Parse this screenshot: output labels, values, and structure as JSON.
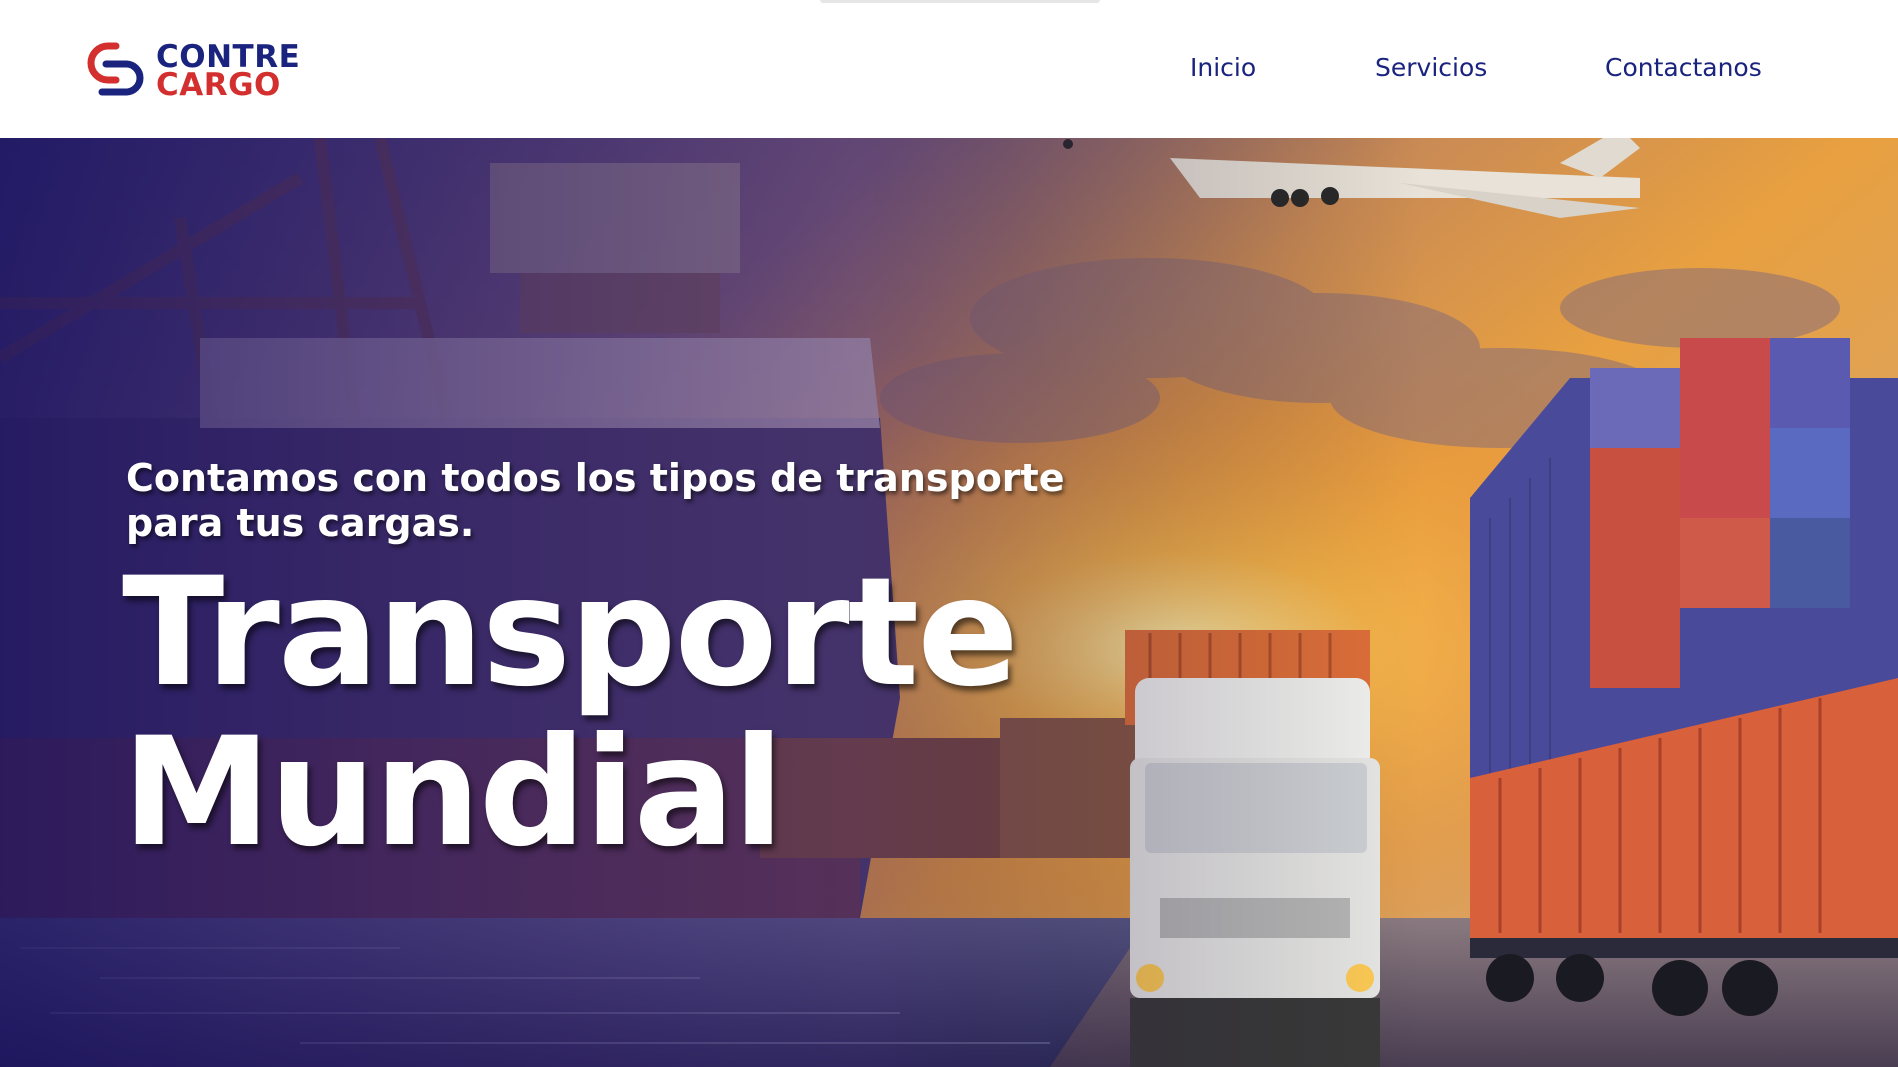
{
  "brand": {
    "name_line1": "CONTRE",
    "name_line2": "CARGO",
    "color_primary": "#1a237e",
    "color_secondary": "#d32f2f"
  },
  "nav": {
    "items": [
      {
        "label": "Inicio"
      },
      {
        "label": "Servicios"
      },
      {
        "label": "Contactanos"
      }
    ]
  },
  "hero": {
    "subtitle": "Contamos con todos los tipos de transporte para tus cargas.",
    "title_line1": "Transporte",
    "title_line2": "Mundial",
    "background_description_icon": "port-trucks-containers-plane-photo"
  }
}
